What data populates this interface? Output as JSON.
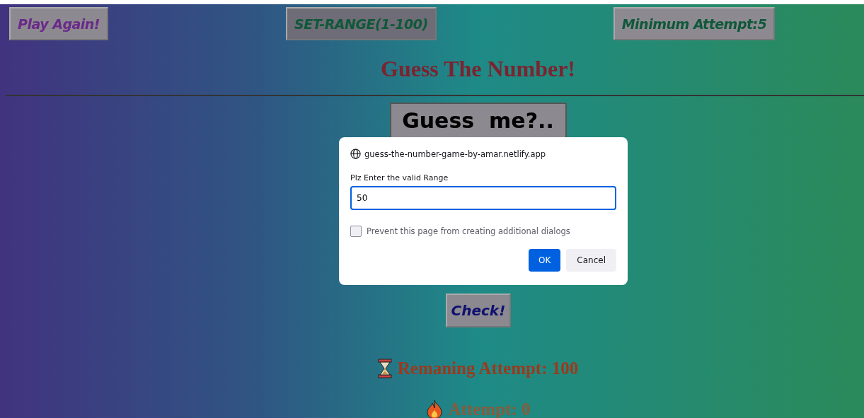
{
  "top_buttons": [
    {
      "label": "Play Again!",
      "kind": "play"
    },
    {
      "label": "SET-RANGE(1-100)",
      "kind": "range"
    },
    {
      "label": "Minimum Attempt:5",
      "kind": "min"
    }
  ],
  "title": "Guess The Number!",
  "guess_box": "Guess  me?..",
  "check_button": "Check!",
  "remaining": "Remaning Attempt: 100",
  "attempt": "Attempt: 0",
  "dialog": {
    "origin": "guess-the-number-game-by-amar.netlify.app",
    "message": "Plz Enter the valid Range",
    "value": "50",
    "prevent": {
      "label": "Prevent this page from creating additional dialogs",
      "checked": false
    },
    "ok": "OK",
    "cancel": "Cancel"
  }
}
